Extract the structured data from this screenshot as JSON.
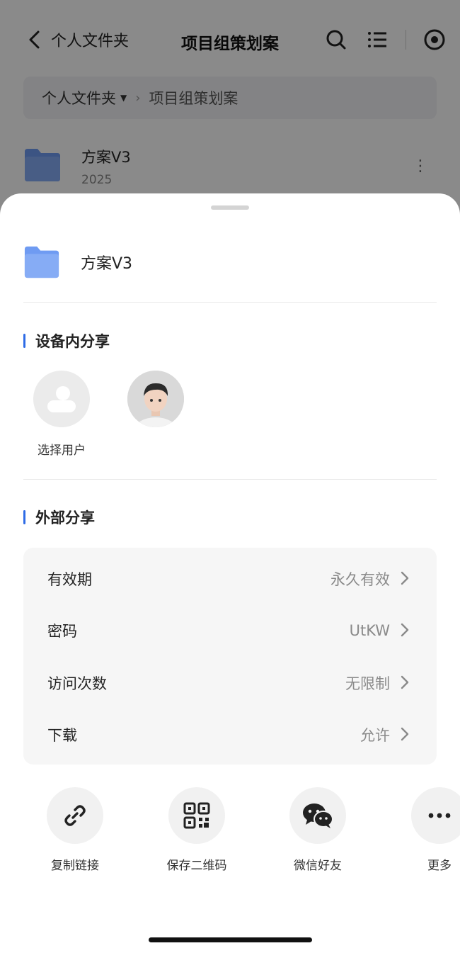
{
  "topbar": {
    "back_label": "个人文件夹",
    "title": "项目组策划案",
    "icons": [
      "search-icon",
      "list-icon",
      "record-icon"
    ]
  },
  "breadcrumb": {
    "root": "个人文件夹",
    "current": "项目组策划案"
  },
  "background_file": {
    "name": "方案V3",
    "meta": "2025"
  },
  "sheet": {
    "file_name": "方案V3",
    "internal_share": {
      "title": "设备内分享",
      "users": [
        {
          "label": "选择用户",
          "icon": "user-placeholder-icon"
        },
        {
          "label": "",
          "icon": "avatar"
        }
      ]
    },
    "external_share": {
      "title": "外部分享",
      "rows": [
        {
          "key": "有效期",
          "value": "永久有效"
        },
        {
          "key": "密码",
          "value": "UtKW"
        },
        {
          "key": "访问次数",
          "value": "无限制"
        },
        {
          "key": "下载",
          "value": "允许"
        }
      ]
    },
    "actions": [
      {
        "label": "复制链接",
        "icon": "link-icon"
      },
      {
        "label": "保存二维码",
        "icon": "qr-code-icon"
      },
      {
        "label": "微信好友",
        "icon": "wechat-icon"
      },
      {
        "label": "更多",
        "icon": "more-icon"
      }
    ]
  },
  "colors": {
    "accent": "#2e6be6",
    "folder": "#6f9bf2",
    "overlay": "rgba(0,0,0,0.46)"
  }
}
